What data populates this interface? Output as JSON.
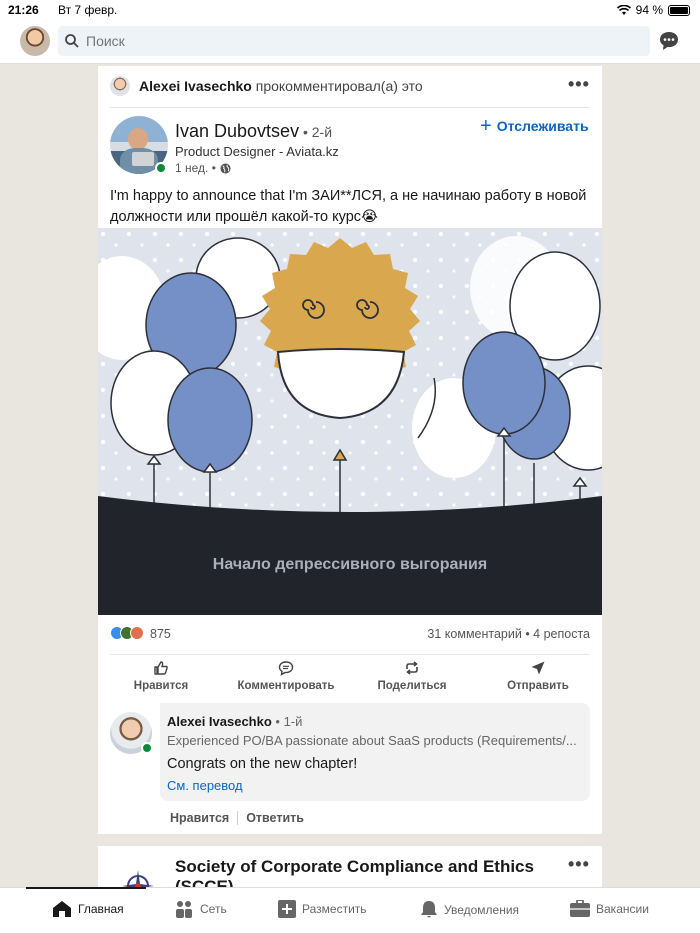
{
  "status_bar": {
    "time": "21:26",
    "date": "Вт 7 февр.",
    "battery": "94 %"
  },
  "search": {
    "placeholder": "Поиск"
  },
  "post": {
    "activity_actor": "Alexei Ivasechko",
    "activity_text": " прокомментировал(а) это",
    "author_name": "Ivan Dubovtsev",
    "author_degree": " • 2-й",
    "author_headline": "Product Designer - Aviata.kz",
    "time": "1 нед. •",
    "follow_label": "Отслеживать",
    "text": "I'm happy to announce that I'm ЗАИ**ЛСЯ, а не начинаю работу в новой должности или прошёл какой-то курс😭",
    "image_caption": "Начало депрессивного выгорания",
    "reactions_count": "875",
    "comments_reposts": "31 комментарий  •  4 репоста",
    "actions": {
      "like": "Нравится",
      "comment": "Комментировать",
      "share": "Поделиться",
      "send": "Отправить"
    }
  },
  "comment": {
    "author_name": "Alexei Ivasechko",
    "author_degree": " • 1-й",
    "headline": "Experienced PO/BA passionate about SaaS products (Requirements/...",
    "text": "Congrats on the new chapter!",
    "translate": "См. перевод",
    "like": "Нравится",
    "reply": "Ответить"
  },
  "next_post": {
    "org_name": "Society of Corporate Compliance and Ethics (SCCE)"
  },
  "bottom_nav": {
    "home": "Главная",
    "network": "Сеть",
    "post": "Разместить",
    "notifications": "Уведомления",
    "jobs": "Вакансии"
  },
  "colors": {
    "accent": "#0a66c2",
    "sun": "#d9a84e",
    "balloon": "#7590c6",
    "online": "#0a8a3a"
  }
}
